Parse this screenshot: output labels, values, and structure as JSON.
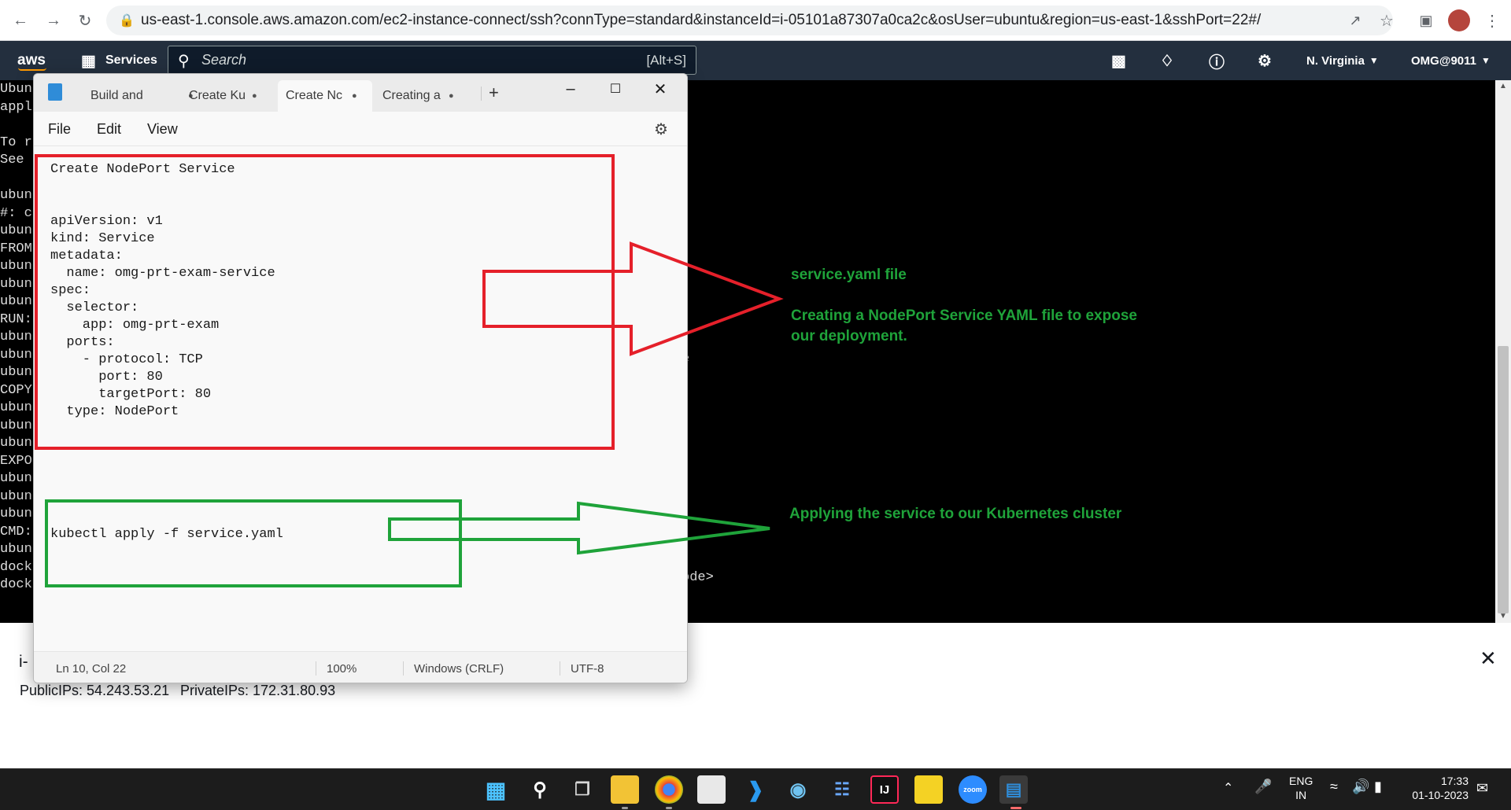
{
  "browser": {
    "url": "us-east-1.console.aws.amazon.com/ec2-instance-connect/ssh?connType=standard&instanceId=i-05101a87307a0ca2c&osUser=ubuntu&region=us-east-1&sshPort=22#/"
  },
  "aws_nav": {
    "logo": "aws",
    "services_label": "Services",
    "search_placeholder": "Search",
    "search_shortcut": "[Alt+S]",
    "region": "N. Virginia",
    "account": "OMG@9011"
  },
  "terminal": {
    "left_lines": [
      "Ubun",
      "appl",
      "",
      "To r",
      "See",
      "",
      "ubun",
      "#: c",
      "ubun",
      "FROM",
      "ubun",
      "ubun",
      "ubun",
      "RUN:",
      "ubun",
      "ubun",
      "ubun",
      "COPY",
      "ubun",
      "ubun",
      "ubun",
      "EXPO",
      "ubun",
      "ubun",
      "ubun",
      "CMD:",
      "ubun",
      "dock",
      "dock"
    ],
    "fragment_1": "e",
    "fragment_2": "ode>"
  },
  "instance_panel": {
    "id_prefix": "i-",
    "public_ips": "PublicIPs: 54.243.53.21",
    "private_ips": "PrivateIPs: 172.31.80.93"
  },
  "notepad": {
    "tabs": [
      {
        "label": "Build and",
        "active": false
      },
      {
        "label": "Create Ku",
        "active": false
      },
      {
        "label": "Create Nc",
        "active": true
      },
      {
        "label": "Creating a",
        "active": false
      }
    ],
    "menu": [
      "File",
      "Edit",
      "View"
    ],
    "content_lines": [
      "Create NodePort Service",
      "",
      "",
      "apiVersion: v1",
      "kind: Service",
      "metadata:",
      "  name: omg-prt-exam-service",
      "spec:",
      "  selector:",
      "    app: omg-prt-exam",
      "  ports:",
      "    - protocol: TCP",
      "      port: 80",
      "      targetPort: 80",
      "  type: NodePort"
    ],
    "command": "kubectl apply -f service.yaml",
    "status": {
      "position": "Ln 10, Col 22",
      "zoom": "100%",
      "line_ending": "Windows (CRLF)",
      "encoding": "UTF-8"
    }
  },
  "annotations": {
    "file_label": "service.yaml file",
    "desc_line1": "Creating a NodePort Service YAML file to expose",
    "desc_line2": "our deployment.",
    "apply_label": "Applying the service to our Kubernetes cluster"
  },
  "taskbar": {
    "language": "ENG",
    "region": "IN",
    "time": "17:33",
    "date": "01-10-2023"
  },
  "colors": {
    "red_box": "#e5202a",
    "green_box": "#1fa33a",
    "aws_nav": "#232f3e",
    "terminal_bg": "#000000"
  }
}
